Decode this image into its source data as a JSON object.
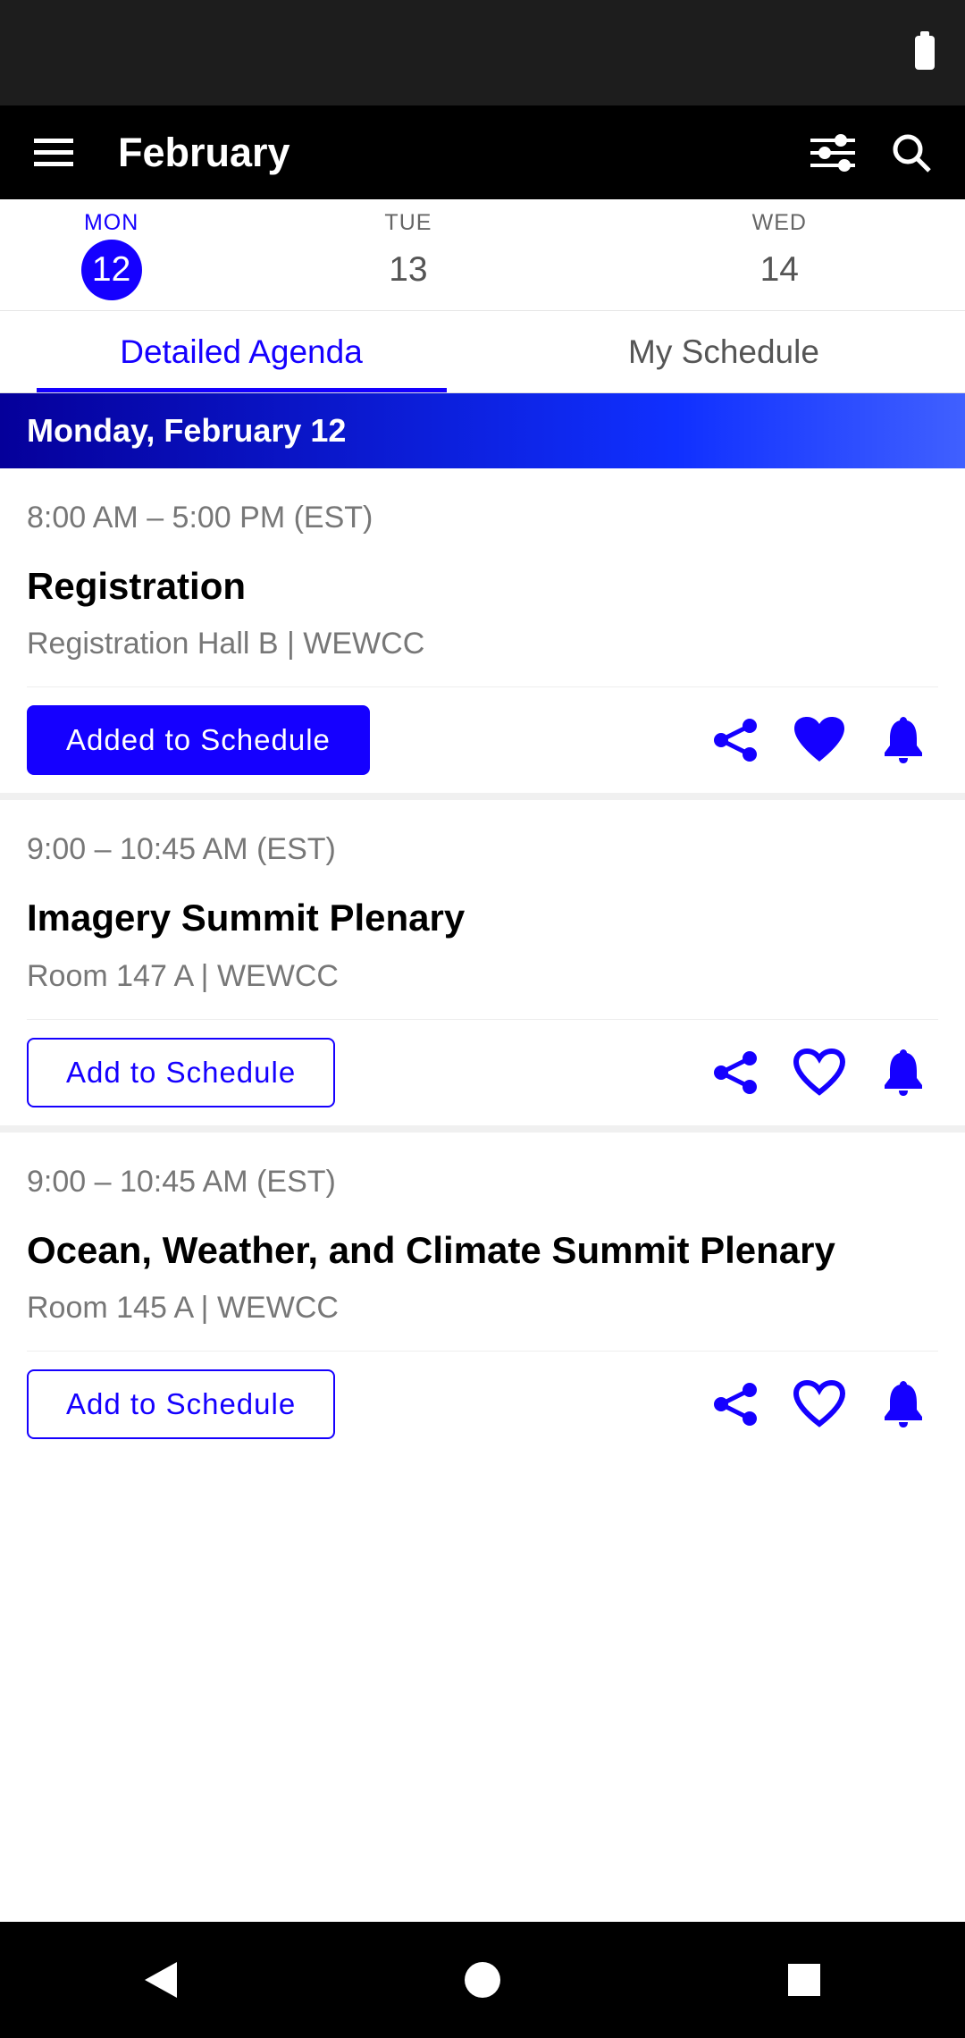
{
  "appBar": {
    "title": "February"
  },
  "days": [
    {
      "label": "MON",
      "num": "12",
      "active": true
    },
    {
      "label": "TUE",
      "num": "13"
    },
    {
      "label": "WED",
      "num": "14"
    }
  ],
  "viewTabs": {
    "detailed": "Detailed Agenda",
    "mySchedule": "My Schedule"
  },
  "dateHeader": "Monday, February 12",
  "sessions": [
    {
      "time": "8:00 AM – 5:00 PM (EST)",
      "title": "Registration",
      "location": "Registration Hall B | WEWCC",
      "button": "Added to Schedule",
      "added": true,
      "favorited": true
    },
    {
      "time": "9:00 – 10:45 AM (EST)",
      "title": "Imagery Summit Plenary",
      "location": "Room 147 A | WEWCC",
      "button": "Add to Schedule",
      "added": false,
      "favorited": false
    },
    {
      "time": "9:00 – 10:45 AM (EST)",
      "title": "Ocean, Weather, and Climate Summit Plenary",
      "location": "Room 145 A | WEWCC",
      "button": "Add to Schedule",
      "added": false,
      "favorited": false
    }
  ],
  "colors": {
    "primary": "#1500ff"
  }
}
